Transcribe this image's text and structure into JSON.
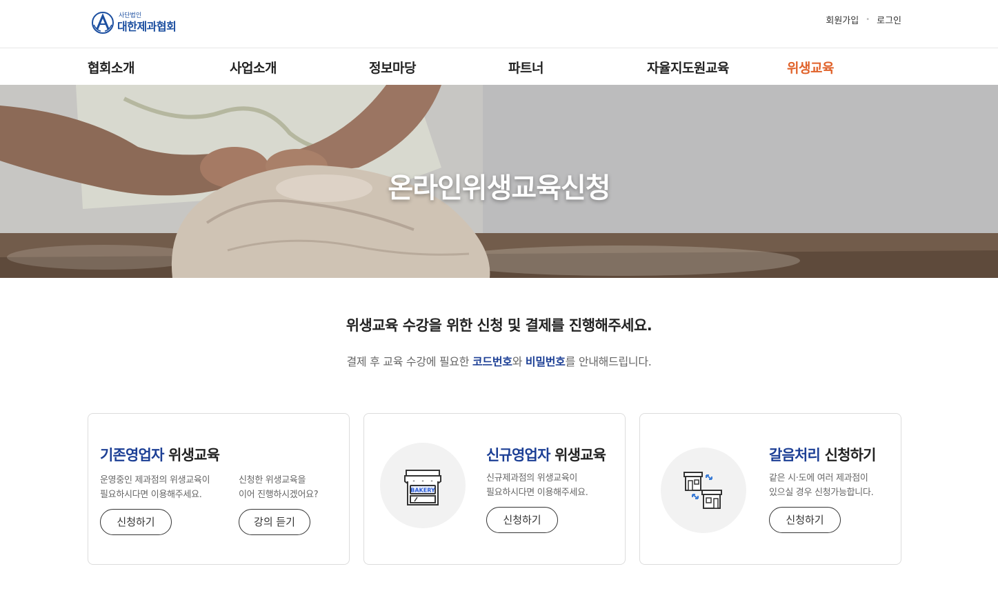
{
  "header": {
    "logo_small": "사단법인",
    "logo_name": "대한제과협회",
    "signup_label": "회원가입",
    "login_label": "로그인"
  },
  "nav": {
    "items": [
      "협회소개",
      "사업소개",
      "정보마당",
      "파트너",
      "자율지도원교육",
      "위생교육"
    ],
    "active_index": 5,
    "active_color": "#e0622a"
  },
  "hero": {
    "title": "온라인위생교육신청"
  },
  "intro": {
    "title": "위생교육 수강을 위한 신청 및 결제를 진행해주세요.",
    "sub_before": "결제 후 교육 수강에 필요한 ",
    "code_label": "코드번호",
    "sub_mid": "와 ",
    "password_label": "비밀번호",
    "sub_after": "를 안내해드립니다."
  },
  "cards": [
    {
      "title_highlight": "기존영업자",
      "title_rest": " 위생교육",
      "desc_left_1": "운영중인 제과점의 위생교육이",
      "desc_left_2": "필요하시다면 이용해주세요.",
      "desc_right_1": "신청한 위생교육을",
      "desc_right_2": "이어 진행하시겠어요?",
      "button_apply": "신청하기",
      "button_lecture": "강의 듣기"
    },
    {
      "title_highlight": "신규영업자",
      "title_rest": " 위생교육",
      "desc_1": "신규제과점의 위생교육이",
      "desc_2": "필요하시다면 이용해주세요.",
      "button_apply": "신청하기",
      "icon": "bakery-store-icon",
      "icon_label": "BAKERY"
    },
    {
      "title_highlight": "갈음처리",
      "title_rest": " 신청하기",
      "desc_1": "같은 시·도에 여러 제과점이",
      "desc_2": "있으실 경우 신청가능합니다.",
      "button_apply": "신청하기",
      "icon": "store-transfer-icon"
    }
  ],
  "colors": {
    "brand_blue": "#1c3f95",
    "accent_orange": "#e0622a"
  }
}
